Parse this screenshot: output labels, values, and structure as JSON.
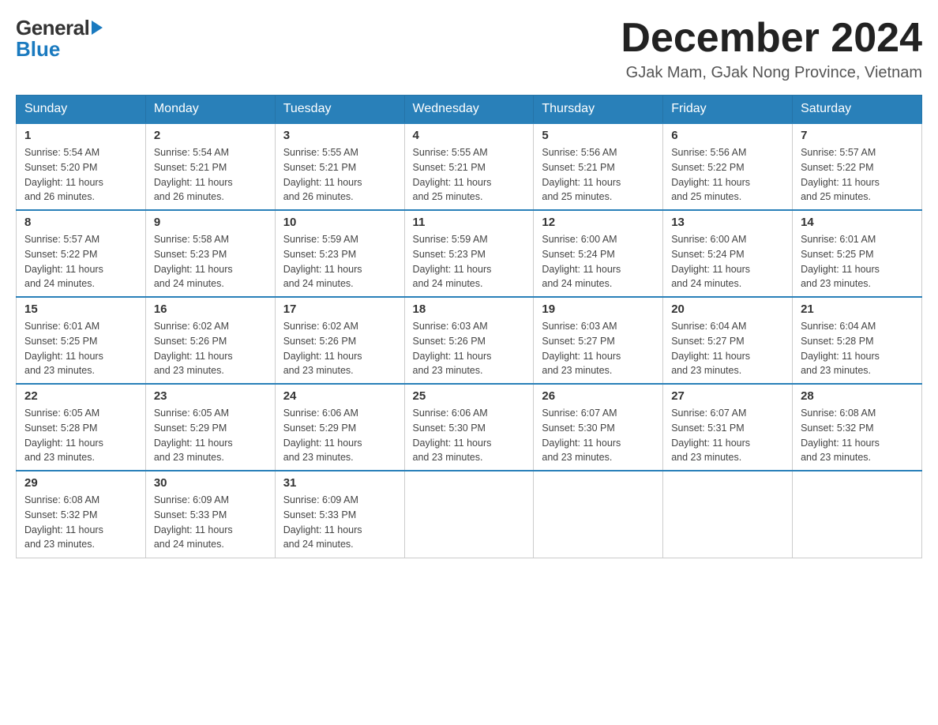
{
  "header": {
    "logo_line1": "General",
    "logo_line2": "Blue",
    "title": "December 2024",
    "subtitle": "GJak Mam, GJak Nong Province, Vietnam"
  },
  "weekdays": [
    "Sunday",
    "Monday",
    "Tuesday",
    "Wednesday",
    "Thursday",
    "Friday",
    "Saturday"
  ],
  "weeks": [
    [
      {
        "day": "1",
        "sunrise": "5:54 AM",
        "sunset": "5:20 PM",
        "daylight": "11 hours and 26 minutes."
      },
      {
        "day": "2",
        "sunrise": "5:54 AM",
        "sunset": "5:21 PM",
        "daylight": "11 hours and 26 minutes."
      },
      {
        "day": "3",
        "sunrise": "5:55 AM",
        "sunset": "5:21 PM",
        "daylight": "11 hours and 26 minutes."
      },
      {
        "day": "4",
        "sunrise": "5:55 AM",
        "sunset": "5:21 PM",
        "daylight": "11 hours and 25 minutes."
      },
      {
        "day": "5",
        "sunrise": "5:56 AM",
        "sunset": "5:21 PM",
        "daylight": "11 hours and 25 minutes."
      },
      {
        "day": "6",
        "sunrise": "5:56 AM",
        "sunset": "5:22 PM",
        "daylight": "11 hours and 25 minutes."
      },
      {
        "day": "7",
        "sunrise": "5:57 AM",
        "sunset": "5:22 PM",
        "daylight": "11 hours and 25 minutes."
      }
    ],
    [
      {
        "day": "8",
        "sunrise": "5:57 AM",
        "sunset": "5:22 PM",
        "daylight": "11 hours and 24 minutes."
      },
      {
        "day": "9",
        "sunrise": "5:58 AM",
        "sunset": "5:23 PM",
        "daylight": "11 hours and 24 minutes."
      },
      {
        "day": "10",
        "sunrise": "5:59 AM",
        "sunset": "5:23 PM",
        "daylight": "11 hours and 24 minutes."
      },
      {
        "day": "11",
        "sunrise": "5:59 AM",
        "sunset": "5:23 PM",
        "daylight": "11 hours and 24 minutes."
      },
      {
        "day": "12",
        "sunrise": "6:00 AM",
        "sunset": "5:24 PM",
        "daylight": "11 hours and 24 minutes."
      },
      {
        "day": "13",
        "sunrise": "6:00 AM",
        "sunset": "5:24 PM",
        "daylight": "11 hours and 24 minutes."
      },
      {
        "day": "14",
        "sunrise": "6:01 AM",
        "sunset": "5:25 PM",
        "daylight": "11 hours and 23 minutes."
      }
    ],
    [
      {
        "day": "15",
        "sunrise": "6:01 AM",
        "sunset": "5:25 PM",
        "daylight": "11 hours and 23 minutes."
      },
      {
        "day": "16",
        "sunrise": "6:02 AM",
        "sunset": "5:26 PM",
        "daylight": "11 hours and 23 minutes."
      },
      {
        "day": "17",
        "sunrise": "6:02 AM",
        "sunset": "5:26 PM",
        "daylight": "11 hours and 23 minutes."
      },
      {
        "day": "18",
        "sunrise": "6:03 AM",
        "sunset": "5:26 PM",
        "daylight": "11 hours and 23 minutes."
      },
      {
        "day": "19",
        "sunrise": "6:03 AM",
        "sunset": "5:27 PM",
        "daylight": "11 hours and 23 minutes."
      },
      {
        "day": "20",
        "sunrise": "6:04 AM",
        "sunset": "5:27 PM",
        "daylight": "11 hours and 23 minutes."
      },
      {
        "day": "21",
        "sunrise": "6:04 AM",
        "sunset": "5:28 PM",
        "daylight": "11 hours and 23 minutes."
      }
    ],
    [
      {
        "day": "22",
        "sunrise": "6:05 AM",
        "sunset": "5:28 PM",
        "daylight": "11 hours and 23 minutes."
      },
      {
        "day": "23",
        "sunrise": "6:05 AM",
        "sunset": "5:29 PM",
        "daylight": "11 hours and 23 minutes."
      },
      {
        "day": "24",
        "sunrise": "6:06 AM",
        "sunset": "5:29 PM",
        "daylight": "11 hours and 23 minutes."
      },
      {
        "day": "25",
        "sunrise": "6:06 AM",
        "sunset": "5:30 PM",
        "daylight": "11 hours and 23 minutes."
      },
      {
        "day": "26",
        "sunrise": "6:07 AM",
        "sunset": "5:30 PM",
        "daylight": "11 hours and 23 minutes."
      },
      {
        "day": "27",
        "sunrise": "6:07 AM",
        "sunset": "5:31 PM",
        "daylight": "11 hours and 23 minutes."
      },
      {
        "day": "28",
        "sunrise": "6:08 AM",
        "sunset": "5:32 PM",
        "daylight": "11 hours and 23 minutes."
      }
    ],
    [
      {
        "day": "29",
        "sunrise": "6:08 AM",
        "sunset": "5:32 PM",
        "daylight": "11 hours and 23 minutes."
      },
      {
        "day": "30",
        "sunrise": "6:09 AM",
        "sunset": "5:33 PM",
        "daylight": "11 hours and 24 minutes."
      },
      {
        "day": "31",
        "sunrise": "6:09 AM",
        "sunset": "5:33 PM",
        "daylight": "11 hours and 24 minutes."
      },
      null,
      null,
      null,
      null
    ]
  ],
  "labels": {
    "sunrise": "Sunrise:",
    "sunset": "Sunset:",
    "daylight": "Daylight:"
  }
}
